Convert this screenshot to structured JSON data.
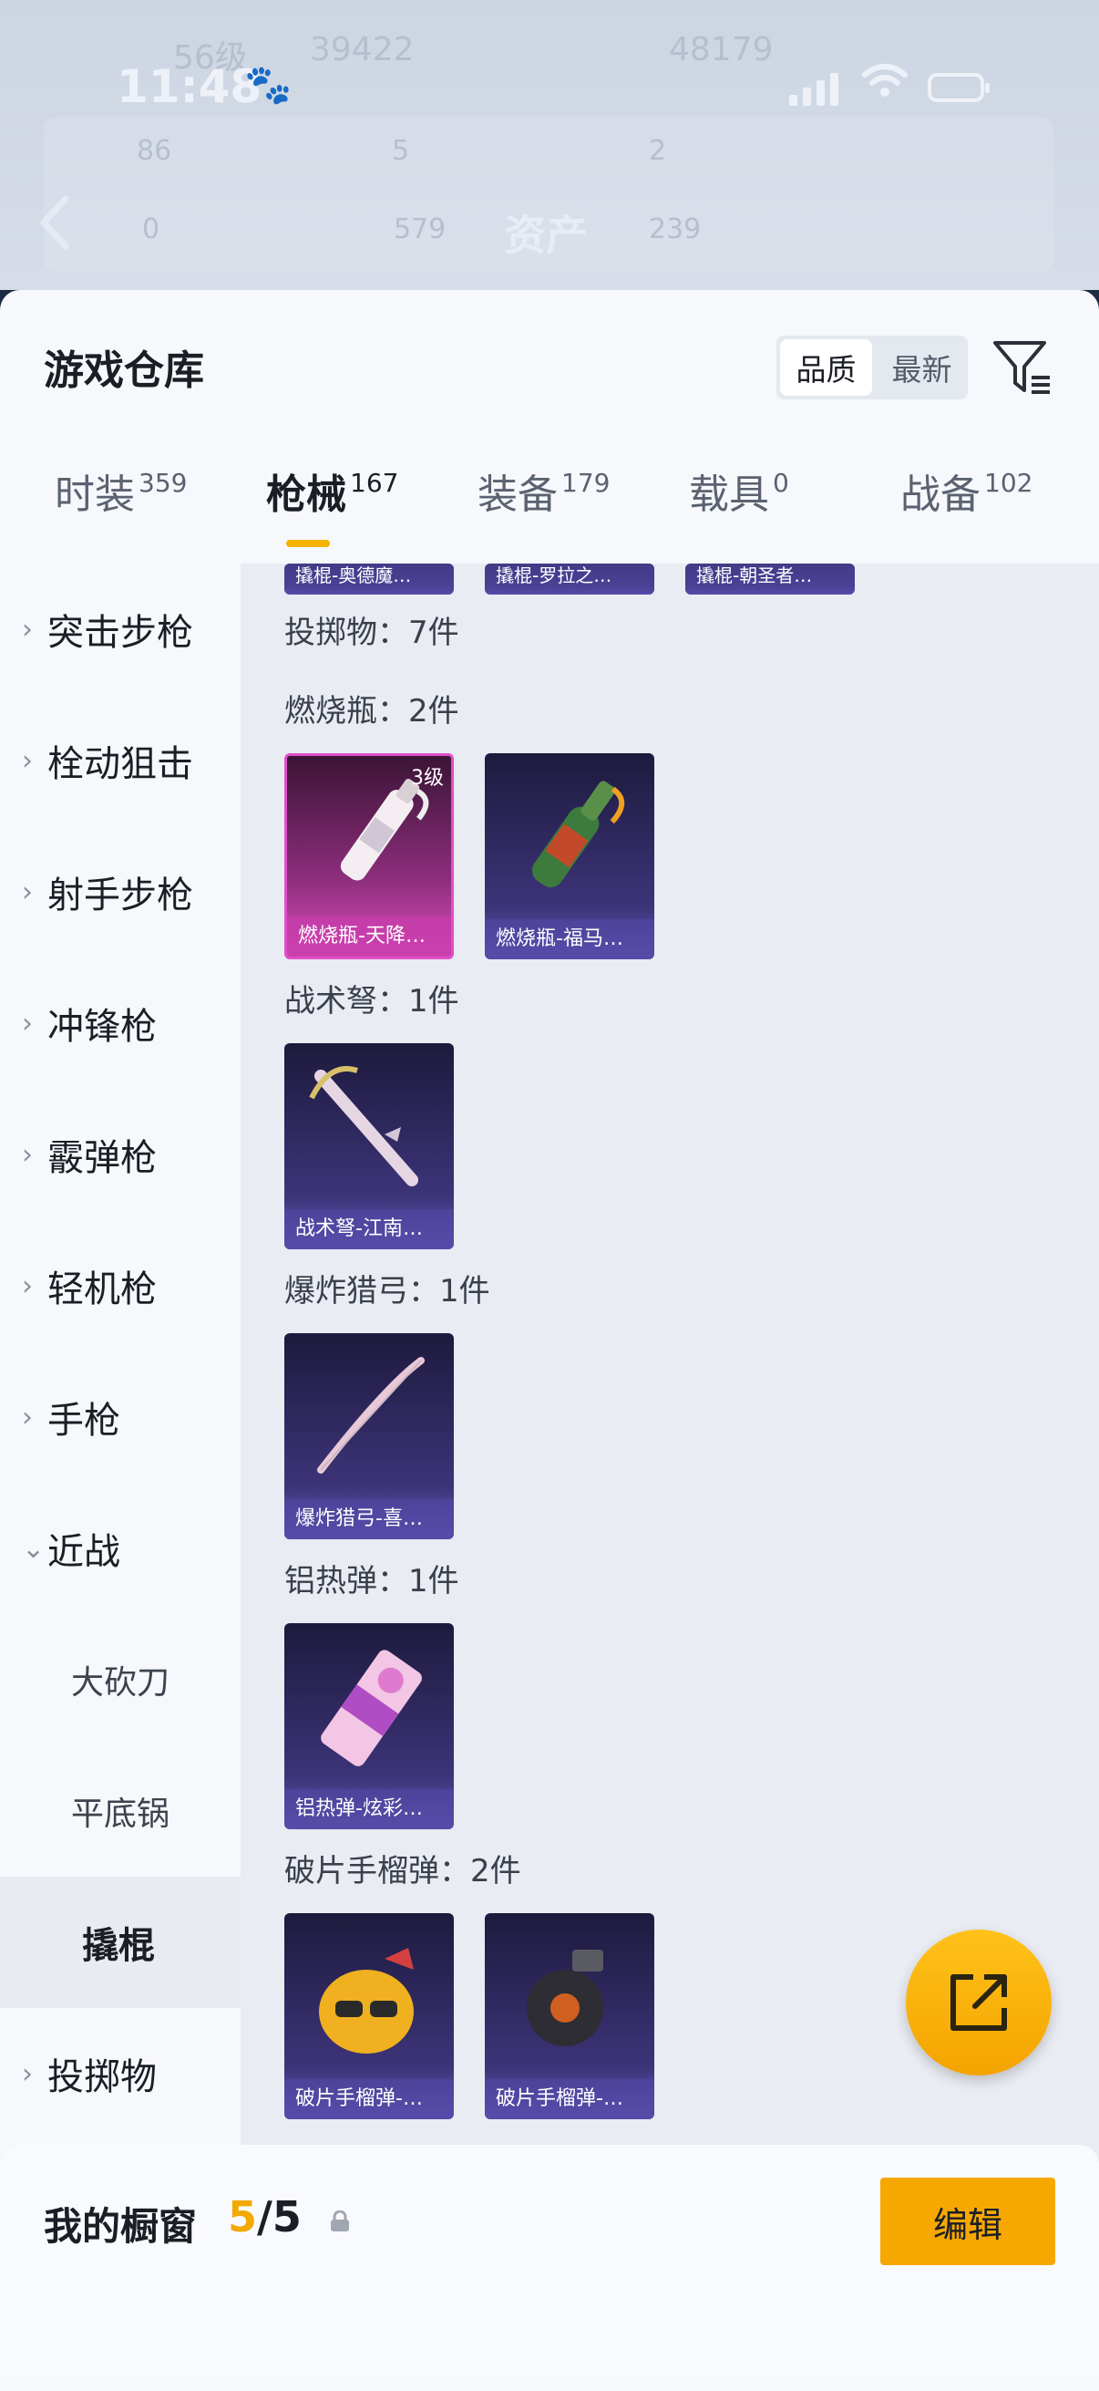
{
  "status_bar": {
    "time": "11:48"
  },
  "background_header": {
    "title": "资产",
    "ghost_texts": [
      "56级",
      "39422",
      "48179",
      "86",
      "5",
      "2",
      "0",
      "579",
      "239"
    ]
  },
  "sheet": {
    "title": "游戏仓库",
    "sort": {
      "quality": "品质",
      "newest": "最新",
      "selected": "品质"
    },
    "tabs": [
      {
        "label": "时装",
        "count": "359"
      },
      {
        "label": "枪械",
        "count": "167",
        "active": true
      },
      {
        "label": "装备",
        "count": "179"
      },
      {
        "label": "载具",
        "count": "0"
      },
      {
        "label": "战备",
        "count": "102"
      }
    ]
  },
  "sidebar": {
    "items": [
      {
        "label": "突击步枪"
      },
      {
        "label": "栓动狙击"
      },
      {
        "label": "射手步枪"
      },
      {
        "label": "冲锋枪"
      },
      {
        "label": "霰弹枪"
      },
      {
        "label": "轻机枪"
      },
      {
        "label": "手枪"
      },
      {
        "label": "近战"
      },
      {
        "label": "大砍刀"
      },
      {
        "label": "平底锅"
      },
      {
        "label": "撬棍"
      },
      {
        "label": "投掷物"
      }
    ]
  },
  "content": {
    "partial_cards": [
      "撬棍-奥德魔…",
      "撬棍-罗拉之…",
      "撬棍-朝圣者…"
    ],
    "group_title": "投掷物：7件",
    "sections": [
      {
        "title": "燃烧瓶：2件",
        "cards": [
          {
            "name": "燃烧瓶-天降…",
            "level": "3级"
          },
          {
            "name": "燃烧瓶-福马…"
          }
        ]
      },
      {
        "title": "战术弩：1件",
        "cards": [
          {
            "name": "战术弩-江南…"
          }
        ]
      },
      {
        "title": "爆炸猎弓：1件",
        "cards": [
          {
            "name": "爆炸猎弓-喜…"
          }
        ]
      },
      {
        "title": "铝热弹：1件",
        "cards": [
          {
            "name": "铝热弹-炫彩…"
          }
        ]
      },
      {
        "title": "破片手榴弹：2件",
        "cards": [
          {
            "name": "破片手榴弹-…"
          },
          {
            "name": "破片手榴弹-…"
          }
        ]
      }
    ]
  },
  "bottom_bar": {
    "label": "我的橱窗",
    "count_current": "5",
    "count_sep_total": "/5",
    "edit_label": "编辑"
  },
  "colors": {
    "accent": "#f5b400",
    "card_purple": "#3d3479",
    "card_pink": "#d84fbd"
  }
}
